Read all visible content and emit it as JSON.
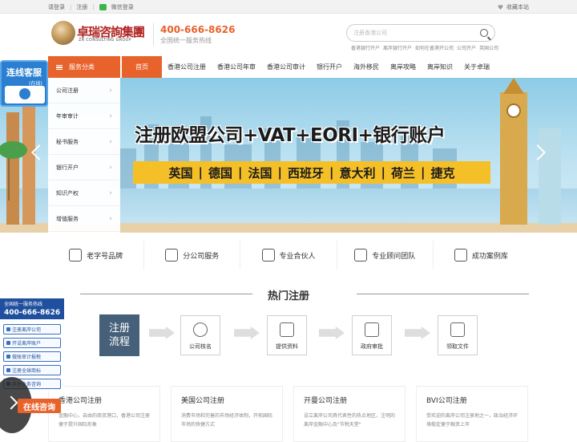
{
  "topbar": {
    "login": "请登录",
    "register": "注册",
    "wechat_login": "微信登录",
    "favorite": "收藏本站"
  },
  "header": {
    "logo_cn": "卓瑞咨詢集團",
    "logo_en": "ZR CONSULTING GROUP",
    "hotline_number": "400-666-8626",
    "hotline_label": "全国统一服务热线",
    "search_placeholder": "注册香港公司",
    "hot_words": [
      "香港银行开户",
      "离岸银行开户",
      "如何在香港开公司",
      "公司开户",
      "英国公司"
    ]
  },
  "nav": {
    "category_label": "服务分类",
    "items": [
      "首页",
      "香港公司注册",
      "香港公司年审",
      "香港公司审计",
      "银行开户",
      "海外移民",
      "离岸攻略",
      "离岸知识",
      "关于卓瑞"
    ]
  },
  "categories": [
    "公司注册",
    "年审审计",
    "秘书服务",
    "银行开户",
    "知识产权",
    "增值服务"
  ],
  "banner": {
    "title": "注册欧盟公司+VAT+EORI+银行账户",
    "countries": [
      "英国",
      "德国",
      "法国",
      "西班牙",
      "意大利",
      "荷兰",
      "捷克"
    ]
  },
  "livechat": {
    "title": "连线客服",
    "subtitle": "(在线)"
  },
  "features": [
    {
      "label": "老字号品牌",
      "icon": "thumbs-up-icon"
    },
    {
      "label": "分公司服务",
      "icon": "building-icon"
    },
    {
      "label": "专业合伙人",
      "icon": "handshake-icon"
    },
    {
      "label": "专业顾问团队",
      "icon": "team-icon"
    },
    {
      "label": "成功案例库",
      "icon": "shield-check-icon"
    }
  ],
  "section": {
    "title": "热门注册"
  },
  "process": {
    "title_line1": "注册",
    "title_line2": "流程",
    "steps": [
      {
        "label": "公司核名",
        "icon": "magnifier-icon"
      },
      {
        "label": "提供资料",
        "icon": "document-icon"
      },
      {
        "label": "政府审批",
        "icon": "edit-icon"
      },
      {
        "label": "领取文件",
        "icon": "briefcase-icon"
      }
    ]
  },
  "cards": [
    {
      "title": "香港公司注册",
      "desc": "金融中心，自由的商贸港口，香港公司注册便于提升国际形象"
    },
    {
      "title": "美国公司注册",
      "desc": "消费市场和完善的市场经济体制，开拓国际市场的快捷方式"
    },
    {
      "title": "开曼公司注册",
      "desc": "设立离岸公司具代表性的热点地区，注明的离岸金融中心及\"节税天堂\""
    },
    {
      "title": "BVI公司注册",
      "desc": "受欢迎的离岸公司注册地之一，政治经济环境稳定便于融资上市"
    }
  ],
  "left_float": {
    "head_label": "全国统一服务热线",
    "head_number": "400-666-8626",
    "items": [
      "注册离岸公司",
      "开设离岸账户",
      "做账审计报税",
      "注册全球商标",
      "其他业务咨询"
    ]
  },
  "consult_button": "在线咨询",
  "colors": {
    "accent": "#e8622c",
    "banner_band": "#f5c027",
    "process_box": "#46607a",
    "float_head": "#1f4f9e"
  }
}
